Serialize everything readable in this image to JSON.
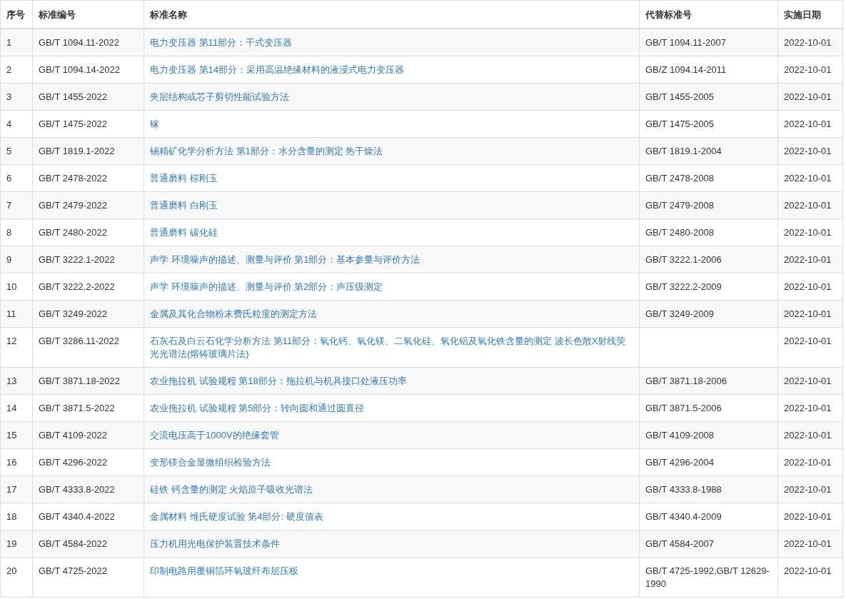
{
  "table": {
    "columns": [
      "序号",
      "标准编号",
      "标准名称",
      "代替标准号",
      "实施日期"
    ],
    "rows": [
      {
        "index": "1",
        "code": "GB/T 1094.11-2022",
        "name": "电力变压器 第11部分：干式变压器",
        "replaces": "GB/T 1094.11-2007",
        "date": "2022-10-01"
      },
      {
        "index": "2",
        "code": "GB/T 1094.14-2022",
        "name": "电力变压器 第14部分：采用高温绝缘材料的液浸式电力变压器",
        "replaces": "GB/Z 1094.14-2011",
        "date": "2022-10-01"
      },
      {
        "index": "3",
        "code": "GB/T 1455-2022",
        "name": "夹层结构或芯子剪切性能试验方法",
        "replaces": "GB/T 1455-2005",
        "date": "2022-10-01"
      },
      {
        "index": "4",
        "code": "GB/T 1475-2022",
        "name": "镓",
        "replaces": "GB/T 1475-2005",
        "date": "2022-10-01"
      },
      {
        "index": "5",
        "code": "GB/T 1819.1-2022",
        "name": "锡精矿化学分析方法 第1部分：水分含量的测定 热干燥法",
        "replaces": "GB/T 1819.1-2004",
        "date": "2022-10-01"
      },
      {
        "index": "6",
        "code": "GB/T 2478-2022",
        "name": "普通磨料 棕刚玉",
        "replaces": "GB/T 2478-2008",
        "date": "2022-10-01"
      },
      {
        "index": "7",
        "code": "GB/T 2479-2022",
        "name": "普通磨料 白刚玉",
        "replaces": "GB/T 2479-2008",
        "date": "2022-10-01"
      },
      {
        "index": "8",
        "code": "GB/T 2480-2022",
        "name": "普通磨料 碳化硅",
        "replaces": "GB/T 2480-2008",
        "date": "2022-10-01"
      },
      {
        "index": "9",
        "code": "GB/T 3222.1-2022",
        "name": "声学 环境噪声的描述、测量与评价 第1部分：基本参量与评价方法",
        "replaces": "GB/T 3222.1-2006",
        "date": "2022-10-01"
      },
      {
        "index": "10",
        "code": "GB/T 3222.2-2022",
        "name": "声学 环境噪声的描述、测量与评价 第2部分：声压级测定",
        "replaces": "GB/T 3222.2-2009",
        "date": "2022-10-01"
      },
      {
        "index": "11",
        "code": "GB/T 3249-2022",
        "name": "金属及其化合物粉末费氏粒度的测定方法",
        "replaces": "GB/T 3249-2009",
        "date": "2022-10-01"
      },
      {
        "index": "12",
        "code": "GB/T 3286.11-2022",
        "name": "石灰石及白云石化学分析方法 第11部分：氧化钙、氧化镁、二氧化硅、氧化铝及氧化铁含量的测定 波长色散X射线荧光光谱法(熔铸玻璃片法)",
        "date": "2022-10-01"
      },
      {
        "index": "13",
        "code": "GB/T 3871.18-2022",
        "name": "农业拖拉机 试验规程 第18部分：拖拉机与机具接口处液压功率",
        "replaces": "GB/T 3871.18-2006",
        "date": "2022-10-01"
      },
      {
        "index": "14",
        "code": "GB/T 3871.5-2022",
        "name": "农业拖拉机 试验规程 第5部分：转向圆和通过圆直径",
        "replaces": "GB/T 3871.5-2006",
        "date": "2022-10-01"
      },
      {
        "index": "15",
        "code": "GB/T 4109-2022",
        "name": "交流电压高于1000V的绝缘套管",
        "replaces": "GB/T 4109-2008",
        "date": "2022-10-01"
      },
      {
        "index": "16",
        "code": "GB/T 4296-2022",
        "name": "变形镁合金显微组织检验方法",
        "replaces": "GB/T 4296-2004",
        "date": "2022-10-01"
      },
      {
        "index": "17",
        "code": "GB/T 4333.8-2022",
        "name": "硅铁 钙含量的测定 火焰原子吸收光谱法",
        "replaces": "GB/T 4333.8-1988",
        "date": "2022-10-01"
      },
      {
        "index": "18",
        "code": "GB/T 4340.4-2022",
        "name": "金属材料 维氏硬度试验 第4部分: 硬度值表",
        "replaces": "GB/T 4340.4-2009",
        "date": "2022-10-01"
      },
      {
        "index": "19",
        "code": "GB/T 4584-2022",
        "name": "压力机用光电保护装置技术条件",
        "replaces": "GB/T 4584-2007",
        "date": "2022-10-01"
      },
      {
        "index": "20",
        "code": "GB/T 4725-2022",
        "name": "印制电路用覆铜箔环氧玻纤布层压板",
        "replaces": "GB/T 4725-1992,GB/T 12629-1990",
        "date": "2022-10-01"
      }
    ]
  }
}
